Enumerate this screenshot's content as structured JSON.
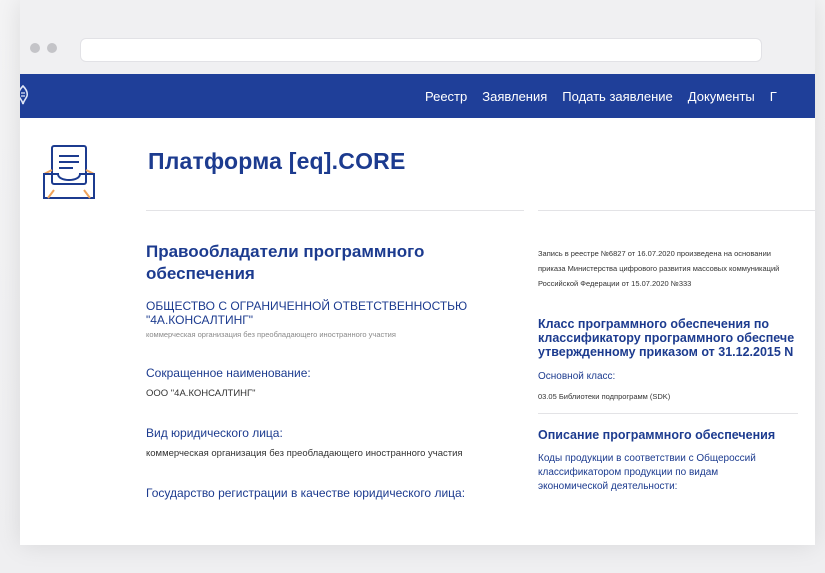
{
  "nav": {
    "items": [
      "Реестр",
      "Заявления",
      "Подать заявление",
      "Документы",
      "Г"
    ]
  },
  "page": {
    "title": "Платформа [eq].CORE"
  },
  "left": {
    "heading": "Правообладатели программного обеспечения",
    "org_name": "ОБЩЕСТВО С ОГРАНИЧЕННОЙ ОТВЕТСТВЕННОСТЬЮ \"4А.КОНСАЛТИНГ\"",
    "org_note": "коммерческая организация без преобладающего иностранного участия",
    "fields": [
      {
        "label": "Сокращенное наименование:",
        "value": "ООО \"4А.КОНСАЛТИНГ\""
      },
      {
        "label": "Вид юридического лица:",
        "value": "коммерческая организация без преобладающего иностранного участия"
      },
      {
        "label": "Государство регистрации в качестве юридического лица:",
        "value": ""
      }
    ]
  },
  "right": {
    "record_note": "Запись в реестре №6827 от 16.07.2020 произведена на основании приказа Министерства цифрового развития массовых коммуникаций Российской Федерации от 15.07.2020 №333",
    "class_heading_lines": [
      "Класс программного обеспечения по",
      "классификатору программного обеспече",
      "утвержденному приказом от 31.12.2015 N"
    ],
    "main_class_label": "Основной класс:",
    "main_class_value": "03.05 Библиотеки подпрограмм (SDK)",
    "description_heading": "Описание программного обеспечения",
    "description_text": "Коды продукции в соответствии с Общероссий классификатором продукции по видам экономической деятельности:"
  },
  "colors": {
    "navbar": "#1f3f99",
    "accent": "#1c3b8f",
    "icon_orange": "#f0a35a"
  },
  "icons": {
    "nav_logo": "eagle-emblem-icon",
    "doc": "document-tray-icon"
  }
}
